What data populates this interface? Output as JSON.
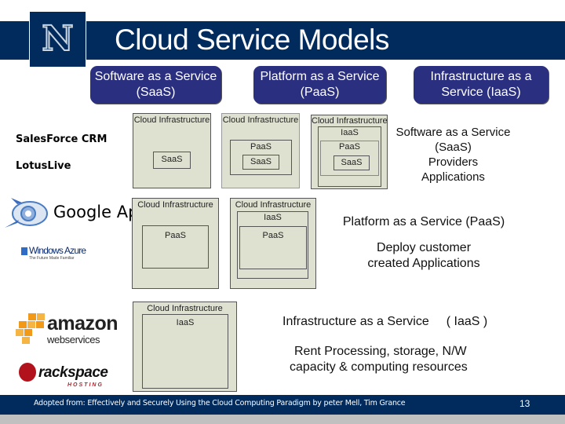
{
  "slide": {
    "title": "Cloud Service Models",
    "logo_letter": "N",
    "page_number": "13",
    "footer": "Adopted from: Effectively and Securely Using the Cloud Computing Paradigm by peter Mell, Tim Grance"
  },
  "headers": [
    {
      "label": "Software as a Service (SaaS)"
    },
    {
      "label": "Platform as a Service (PaaS)"
    },
    {
      "label": "Infrastructure as a Service (IaaS)"
    }
  ],
  "providers": {
    "saas": [
      "SalesForce CRM",
      "LotusLive"
    ],
    "paas": [
      "Google App"
    ],
    "paas_logo": "Windows Azure",
    "paas_logo_tagline": "The Future Made Familiar",
    "iaas_logo_1": "amazon",
    "iaas_logo_1_sub": "webservices",
    "iaas_logo_2": "rackspace",
    "iaas_logo_2_sub": "HOSTING"
  },
  "diagram_labels": {
    "cloud": "Cloud Infrastructure",
    "saas": "SaaS",
    "paas": "PaaS",
    "iaas": "IaaS"
  },
  "descriptions": {
    "saas": {
      "line1": "Software as a Service",
      "line2": "(SaaS)",
      "line3": "Providers",
      "line4": "Applications"
    },
    "paas": {
      "line1": "Platform as a Service (PaaS)",
      "line2": "Deploy customer",
      "line3": "created Applications"
    },
    "iaas": {
      "line1": "Infrastructure as a Service",
      "line1b": "( IaaS )",
      "line2": "Rent Processing, storage, N/W",
      "line3": "capacity &  computing resources"
    }
  },
  "colors": {
    "brand": "#002b5c",
    "pill": "#2a2f80",
    "diagram_bg": "#dfe1d0"
  }
}
